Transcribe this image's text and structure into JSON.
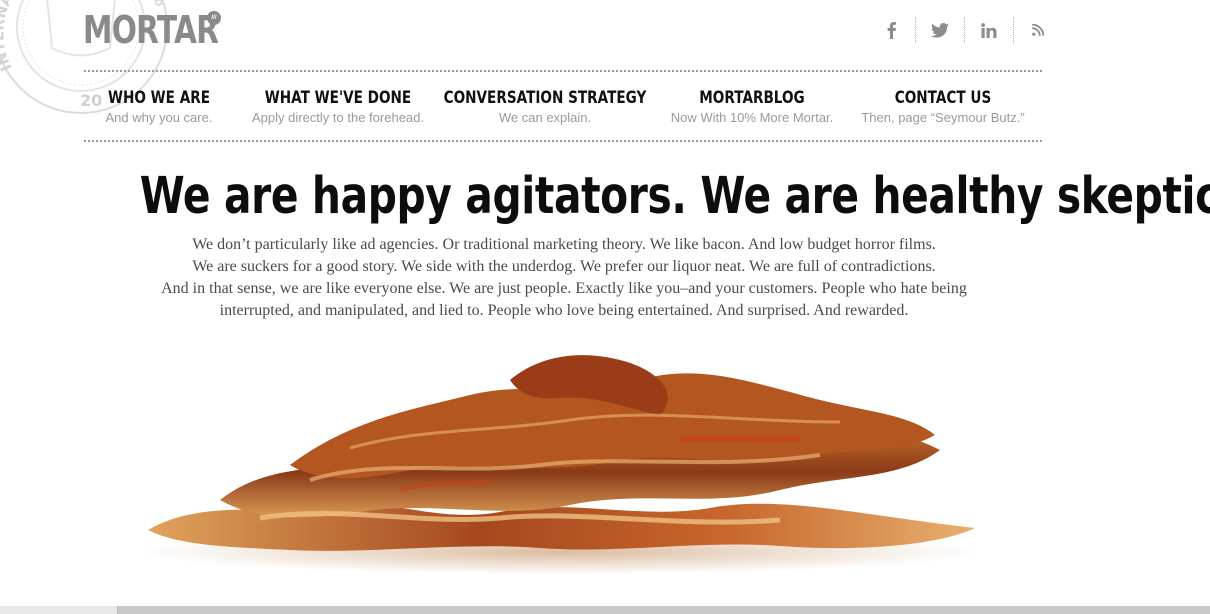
{
  "brand": {
    "name": "MORTAR",
    "mark": "®"
  },
  "seal": {
    "text_left": "INTERNATIONAL",
    "text_right": "REGISTERED",
    "year_start": "20"
  },
  "social": [
    {
      "name": "facebook-icon",
      "glyph": "f"
    },
    {
      "name": "twitter-icon",
      "glyph": ""
    },
    {
      "name": "linkedin-icon",
      "glyph": "in"
    },
    {
      "name": "rss-icon",
      "glyph": ""
    }
  ],
  "nav": [
    {
      "label": "WHO WE ARE",
      "sub": "And why you care."
    },
    {
      "label": "WHAT WE'VE DONE",
      "sub": "Apply directly to the forehead."
    },
    {
      "label": "CONVERSATION STRATEGY",
      "sub": "We can explain."
    },
    {
      "label": "MORTARBLOG",
      "sub": "Now With 10% More Mortar."
    },
    {
      "label": "CONTACT US",
      "sub": "Then, page “Seymour Butz.”"
    }
  ],
  "headline": "We are happy agitators. We are healthy skeptics.",
  "intro": [
    "We don’t particularly like ad agencies. Or traditional marketing theory. We like bacon. And low budget horror films.",
    "We are suckers for a good story. We side with the underdog. We prefer our liquor neat. We are full of contradictions.",
    "And in that sense, we are like everyone else. We are just people. Exactly like you–and your customers. People who hate being",
    "interrupted, and manipulated, and lied to. People who love being entertained. And surprised. And rewarded."
  ],
  "colors": {
    "logo": "#8a8a8a",
    "text": "#111111",
    "sub": "#9a9a9a",
    "body": "#4a4a4a",
    "bacon_dark": "#7a2e14",
    "bacon_light": "#e0a060"
  }
}
